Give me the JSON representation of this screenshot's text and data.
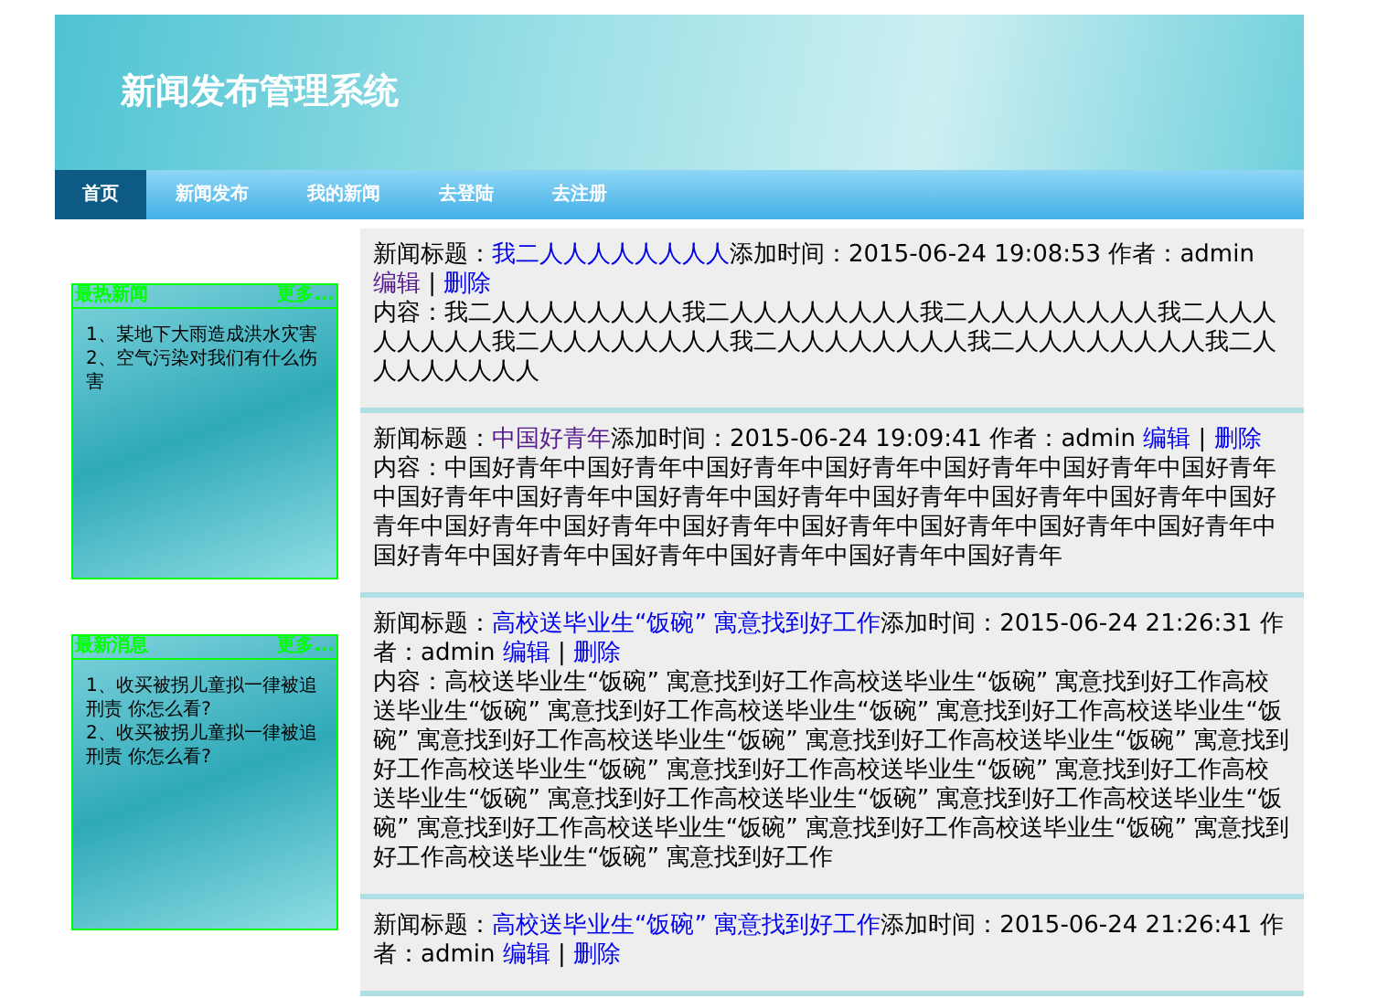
{
  "header": {
    "title": "新闻发布管理系统"
  },
  "nav": [
    {
      "label": "首页",
      "selected": true
    },
    {
      "label": "新闻发布",
      "selected": false
    },
    {
      "label": "我的新闻",
      "selected": false
    },
    {
      "label": "去登陆",
      "selected": false
    },
    {
      "label": "去注册",
      "selected": false
    }
  ],
  "sidebar": {
    "panels": [
      {
        "title": "最热新闻",
        "more": "更多...",
        "items": [
          "1、某地下大雨造成洪水灾害",
          "2、空气污染对我们有什么伤害"
        ]
      },
      {
        "title": "最新消息",
        "more": "更多...",
        "items": [
          "1、收买被拐儿童拟一律被追刑责 你怎么看?",
          "2、收买被拐儿童拟一律被追刑责 你怎么看?"
        ]
      }
    ]
  },
  "news": [
    {
      "title_label": "新闻标题：",
      "title": "我二人人人人人人人人",
      "title_visited": false,
      "time_label": "添加时间：",
      "time": "2015-06-24 19:08:53",
      "author_label": "作者：",
      "author": "admin",
      "edit": "编辑",
      "edit_visited": true,
      "separator": "|",
      "delete": "删除",
      "delete_visited": false,
      "content_label": "内容：",
      "content": "我二人人人人人人人人我二人人人人人人人人我二人人人人人人人人我二人人人人人人人人我二人人人人人人人人我二人人人人人人人人我二人人人人人人人人我二人人人人人人人人"
    },
    {
      "title_label": "新闻标题：",
      "title": "中国好青年",
      "title_visited": true,
      "time_label": "添加时间：",
      "time": "2015-06-24 19:09:41",
      "author_label": "作者：",
      "author": "admin",
      "edit": "编辑",
      "edit_visited": false,
      "separator": "|",
      "delete": "删除",
      "delete_visited": false,
      "content_label": "内容：",
      "content": "中国好青年中国好青年中国好青年中国好青年中国好青年中国好青年中国好青年中国好青年中国好青年中国好青年中国好青年中国好青年中国好青年中国好青年中国好青年中国好青年中国好青年中国好青年中国好青年中国好青年中国好青年中国好青年中国好青年中国好青年中国好青年中国好青年中国好青年中国好青年"
    },
    {
      "title_label": "新闻标题：",
      "title": "高校送毕业生“饭碗” 寓意找到好工作",
      "title_visited": false,
      "time_label": "添加时间：",
      "time": "2015-06-24 21:26:31",
      "author_label": "作者：",
      "author": "admin",
      "edit": "编辑",
      "edit_visited": false,
      "separator": "|",
      "delete": "删除",
      "delete_visited": false,
      "content_label": "内容：",
      "content": "高校送毕业生“饭碗” 寓意找到好工作高校送毕业生“饭碗” 寓意找到好工作高校送毕业生“饭碗” 寓意找到好工作高校送毕业生“饭碗” 寓意找到好工作高校送毕业生“饭碗” 寓意找到好工作高校送毕业生“饭碗” 寓意找到好工作高校送毕业生“饭碗” 寓意找到好工作高校送毕业生“饭碗” 寓意找到好工作高校送毕业生“饭碗” 寓意找到好工作高校送毕业生“饭碗” 寓意找到好工作高校送毕业生“饭碗” 寓意找到好工作高校送毕业生“饭碗” 寓意找到好工作高校送毕业生“饭碗” 寓意找到好工作高校送毕业生“饭碗” 寓意找到好工作高校送毕业生“饭碗” 寓意找到好工作"
    },
    {
      "title_label": "新闻标题：",
      "title": "高校送毕业生“饭碗” 寓意找到好工作",
      "title_visited": false,
      "time_label": "添加时间：",
      "time": "2015-06-24 21:26:41",
      "author_label": "作者：",
      "author": "admin",
      "edit": "编辑",
      "edit_visited": false,
      "separator": "|",
      "delete": "删除",
      "delete_visited": false
    }
  ]
}
